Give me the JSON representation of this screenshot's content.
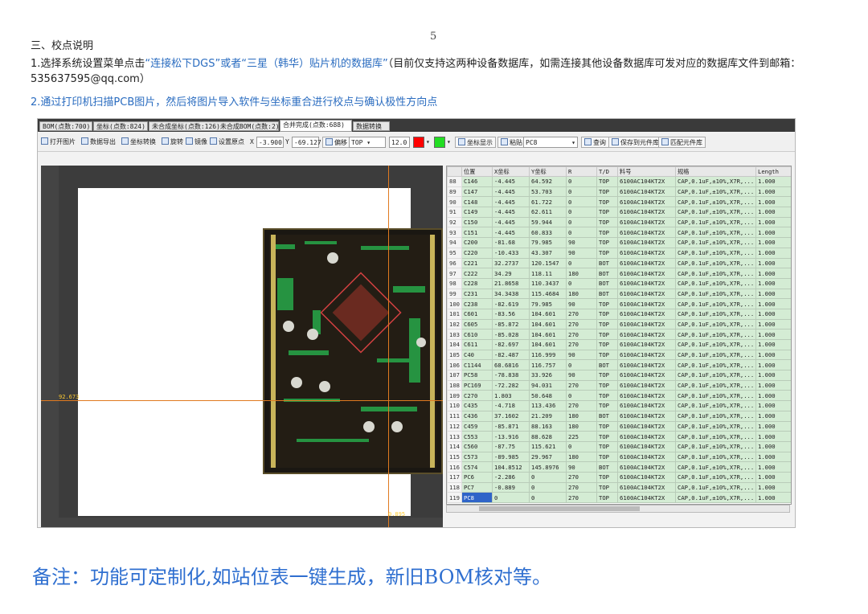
{
  "page_number": "5",
  "section_title": "三、校点说明",
  "step1_prefix": "1.选择系统设置菜单点击",
  "step1_blue": "“连接松下DGS”或者“三星（韩华）贴片机的数据库”",
  "step1_suffix": "（目前仅支持这两种设备数据库，如需连接其他设备数据库可发对应的数据库文件到邮箱：535637595@qq.com）",
  "step2": "2.通过打印机扫描PCB图片，然后将图片导入软件与坐标重合进行校点与确认极性方向点",
  "note": "备注：功能可定制化,如站位表一键生成，新旧BOM核对等。",
  "tabs": [
    {
      "label": "BOM(点数:700)",
      "active": false
    },
    {
      "label": "坐标(点数:824)",
      "active": false
    },
    {
      "label": "未合成坐标(点数:126)未合成BOM(点数:2)",
      "active": false
    },
    {
      "label": "合并完成(点数:688)",
      "active": true
    },
    {
      "label": "数据转换",
      "active": false
    }
  ],
  "toolbar": {
    "open_image": "打开图片",
    "export": "数据导出",
    "coord_convert": "坐标转换",
    "rotate": "旋转",
    "mirror": "镜像",
    "set_origin": "设置原点",
    "x_label": "X",
    "x_value": "-3.900",
    "y_label": "Y",
    "y_value": "-69.127",
    "offset": "偏移",
    "side": "TOP",
    "size_value": "12.0",
    "show_coord": "坐标显示",
    "paste": "粘贴",
    "search_value": "PC8",
    "query": "查询",
    "save_to_lib": "保存到元件库",
    "match_lib": "匹配元件库"
  },
  "colors": {
    "red": "#ff0000",
    "green": "#22dd22",
    "crosshair": "#e07a20",
    "cell": "#d4ecd4",
    "selection": "#2f64c8"
  },
  "canvas": {
    "coord_readout": "92.673",
    "bottom_readout": "0.895"
  },
  "table": {
    "headers": [
      "",
      "位置",
      "X坐标",
      "Y坐标",
      "R",
      "T/D",
      "料号",
      "规格",
      "Length"
    ],
    "rows": [
      [
        "88",
        "C146",
        "-4.445",
        "64.592",
        "0",
        "TOP",
        "6100AC104KT2X",
        "CAP,0.1uF,±10%,X7R,...",
        "1.000"
      ],
      [
        "89",
        "C147",
        "-4.445",
        "53.703",
        "0",
        "TOP",
        "6100AC104KT2X",
        "CAP,0.1uF,±10%,X7R,...",
        "1.000"
      ],
      [
        "90",
        "C148",
        "-4.445",
        "61.722",
        "0",
        "TOP",
        "6100AC104KT2X",
        "CAP,0.1uF,±10%,X7R,...",
        "1.000"
      ],
      [
        "91",
        "C149",
        "-4.445",
        "62.611",
        "0",
        "TOP",
        "6100AC104KT2X",
        "CAP,0.1uF,±10%,X7R,...",
        "1.000"
      ],
      [
        "92",
        "C150",
        "-4.445",
        "59.944",
        "0",
        "TOP",
        "6100AC104KT2X",
        "CAP,0.1uF,±10%,X7R,...",
        "1.000"
      ],
      [
        "93",
        "C151",
        "-4.445",
        "60.833",
        "0",
        "TOP",
        "6100AC104KT2X",
        "CAP,0.1uF,±10%,X7R,...",
        "1.000"
      ],
      [
        "94",
        "C200",
        "-81.68",
        "79.985",
        "90",
        "TOP",
        "6100AC104KT2X",
        "CAP,0.1uF,±10%,X7R,...",
        "1.000"
      ],
      [
        "95",
        "C220",
        "-10.433",
        "43.307",
        "90",
        "TOP",
        "6100AC104KT2X",
        "CAP,0.1uF,±10%,X7R,...",
        "1.000"
      ],
      [
        "96",
        "C221",
        "32.2737",
        "120.1547",
        "0",
        "BOT",
        "6100AC104KT2X",
        "CAP,0.1uF,±10%,X7R,...",
        "1.000"
      ],
      [
        "97",
        "C222",
        "34.29",
        "118.11",
        "180",
        "BOT",
        "6100AC104KT2X",
        "CAP,0.1uF,±10%,X7R,...",
        "1.000"
      ],
      [
        "98",
        "C228",
        "21.8658",
        "110.3437",
        "0",
        "BOT",
        "6100AC104KT2X",
        "CAP,0.1uF,±10%,X7R,...",
        "1.000"
      ],
      [
        "99",
        "C231",
        "34.3438",
        "115.4684",
        "180",
        "BOT",
        "6100AC104KT2X",
        "CAP,0.1uF,±10%,X7R,...",
        "1.000"
      ],
      [
        "100",
        "C238",
        "-82.619",
        "79.985",
        "90",
        "TOP",
        "6100AC104KT2X",
        "CAP,0.1uF,±10%,X7R,...",
        "1.000"
      ],
      [
        "101",
        "C601",
        "-83.56",
        "104.601",
        "270",
        "TOP",
        "6100AC104KT2X",
        "CAP,0.1uF,±10%,X7R,...",
        "1.000"
      ],
      [
        "102",
        "C605",
        "-85.872",
        "104.601",
        "270",
        "TOP",
        "6100AC104KT2X",
        "CAP,0.1uF,±10%,X7R,...",
        "1.000"
      ],
      [
        "103",
        "C610",
        "-85.028",
        "104.601",
        "270",
        "TOP",
        "6100AC104KT2X",
        "CAP,0.1uF,±10%,X7R,...",
        "1.000"
      ],
      [
        "104",
        "C611",
        "-82.697",
        "104.601",
        "270",
        "TOP",
        "6100AC104KT2X",
        "CAP,0.1uF,±10%,X7R,...",
        "1.000"
      ],
      [
        "105",
        "C40",
        "-82.487",
        "116.999",
        "90",
        "TOP",
        "6100AC104KT2X",
        "CAP,0.1uF,±10%,X7R,...",
        "1.000"
      ],
      [
        "106",
        "C1144",
        "68.6816",
        "116.757",
        "0",
        "BOT",
        "6100AC104KT2X",
        "CAP,0.1uF,±10%,X7R,...",
        "1.000"
      ],
      [
        "107",
        "PC58",
        "-78.838",
        "33.926",
        "90",
        "TOP",
        "6100AC104KT2X",
        "CAP,0.1uF,±10%,X7R,...",
        "1.000"
      ],
      [
        "108",
        "PC169",
        "-72.282",
        "94.031",
        "270",
        "TOP",
        "6100AC104KT2X",
        "CAP,0.1uF,±10%,X7R,...",
        "1.000"
      ],
      [
        "109",
        "C270",
        "1.803",
        "50.648",
        "0",
        "TOP",
        "6100AC104KT2X",
        "CAP,0.1uF,±10%,X7R,...",
        "1.000"
      ],
      [
        "110",
        "C435",
        "-4.718",
        "113.436",
        "270",
        "TOP",
        "6100AC104KT2X",
        "CAP,0.1uF,±10%,X7R,...",
        "1.000"
      ],
      [
        "111",
        "C436",
        "37.1602",
        "21.209",
        "180",
        "BOT",
        "6100AC104KT2X",
        "CAP,0.1uF,±10%,X7R,...",
        "1.000"
      ],
      [
        "112",
        "C459",
        "-85.871",
        "88.163",
        "180",
        "TOP",
        "6100AC104KT2X",
        "CAP,0.1uF,±10%,X7R,...",
        "1.000"
      ],
      [
        "113",
        "C553",
        "-13.916",
        "88.628",
        "225",
        "TOP",
        "6100AC104KT2X",
        "CAP,0.1uF,±10%,X7R,...",
        "1.000"
      ],
      [
        "114",
        "C560",
        "-87.75",
        "115.621",
        "0",
        "TOP",
        "6100AC104KT2X",
        "CAP,0.1uF,±10%,X7R,...",
        "1.000"
      ],
      [
        "115",
        "C573",
        "-89.985",
        "29.967",
        "180",
        "TOP",
        "6100AC104KT2X",
        "CAP,0.1uF,±10%,X7R,...",
        "1.000"
      ],
      [
        "116",
        "C574",
        "104.8512",
        "145.8976",
        "90",
        "BOT",
        "6100AC104KT2X",
        "CAP,0.1uF,±10%,X7R,...",
        "1.000"
      ],
      [
        "117",
        "PC6",
        "-2.286",
        "0",
        "270",
        "TOP",
        "6100AC104KT2X",
        "CAP,0.1uF,±10%,X7R,...",
        "1.000"
      ],
      [
        "118",
        "PC7",
        "-0.889",
        "0",
        "270",
        "TOP",
        "6100AC104KT2X",
        "CAP,0.1uF,±10%,X7R,...",
        "1.000"
      ],
      [
        "119",
        "PC8",
        "0",
        "0",
        "270",
        "TOP",
        "6100AC104KT2X",
        "CAP,0.1uF,±10%,X7R,...",
        "1.000"
      ]
    ],
    "selected_row": 31
  }
}
